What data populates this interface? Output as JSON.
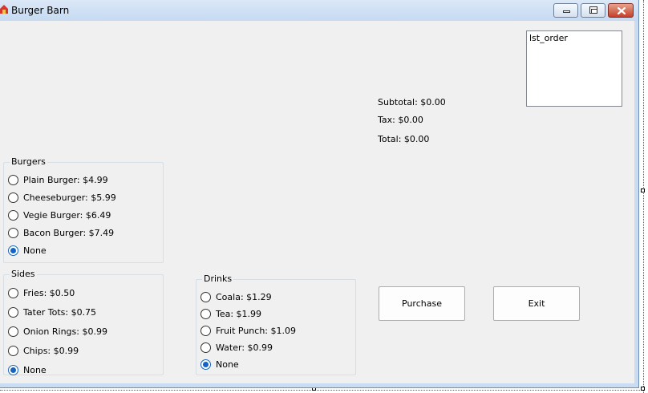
{
  "window": {
    "title": "Burger Barn",
    "icon": "barn-icon",
    "controls": {
      "minimize": "minimize-icon",
      "maximize": "maximize-icon",
      "close": "close-icon"
    }
  },
  "listbox": {
    "items": [
      "lst_order"
    ]
  },
  "totals": {
    "subtotal": "Subtotal: $0.00",
    "tax": "Tax: $0.00",
    "total": "Total: $0.00"
  },
  "burgers": {
    "title": "Burgers",
    "options": [
      "Plain Burger: $4.99",
      "Cheeseburger: $5.99",
      "Vegie Burger: $6.49",
      "Bacon Burger: $7.49",
      "None"
    ],
    "selected": "None"
  },
  "sides": {
    "title": "Sides",
    "options": [
      "Fries: $0.50",
      "Tater Tots: $0.75",
      "Onion Rings: $0.99",
      "Chips: $0.99",
      "None"
    ],
    "selected": "None"
  },
  "drinks": {
    "title": "Drinks",
    "options": [
      "Coala: $1.29",
      "Tea: $1.99",
      "Fruit Punch: $1.09",
      "Water: $0.99",
      "None"
    ],
    "selected": "None"
  },
  "buttons": {
    "purchase": "Purchase",
    "exit": "Exit"
  },
  "colors": {
    "accent": "#1565c0",
    "titlebar": "#c9dcf1",
    "client": "#f0f0f0",
    "close": "#c5412a"
  }
}
